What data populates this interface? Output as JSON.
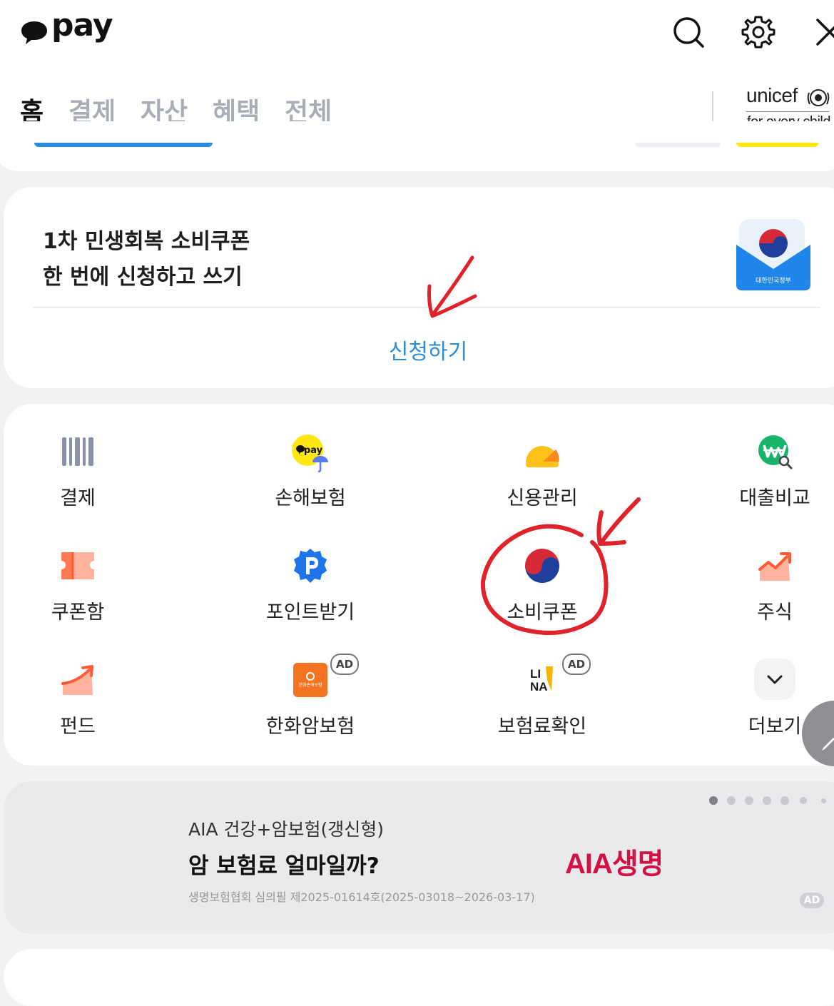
{
  "header": {
    "logo_text": "pay",
    "search_icon": "search-icon",
    "settings_icon": "gear-icon",
    "close_icon": "close-icon"
  },
  "tabs": [
    {
      "label": "홈",
      "active": true
    },
    {
      "label": "결제",
      "active": false
    },
    {
      "label": "자산",
      "active": false
    },
    {
      "label": "혜택",
      "active": false
    },
    {
      "label": "전체",
      "active": false
    }
  ],
  "partner": {
    "name": "unicef",
    "tagline": "for every child"
  },
  "banner": {
    "title_line1": "1차 민생회복 소비쿠폰",
    "title_line2": "한 번에 신청하고 쓰기",
    "envelope_label": "대한민국정부",
    "apply_label": "신청하기"
  },
  "shortcuts": [
    {
      "label": "결제",
      "icon": "barcode-icon",
      "ad": false
    },
    {
      "label": "손해보험",
      "icon": "kakaopay-insurance-icon",
      "ad": false,
      "icon_text": "pay"
    },
    {
      "label": "신용관리",
      "icon": "credit-gauge-icon",
      "ad": false
    },
    {
      "label": "대출비교",
      "icon": "won-search-icon",
      "ad": false
    },
    {
      "label": "쿠폰함",
      "icon": "coupon-icon",
      "ad": false
    },
    {
      "label": "포인트받기",
      "icon": "point-badge-icon",
      "ad": false
    },
    {
      "label": "소비쿠폰",
      "icon": "taegeuk-icon",
      "ad": false
    },
    {
      "label": "주식",
      "icon": "stock-chart-icon",
      "ad": false
    },
    {
      "label": "펀드",
      "icon": "fund-arrow-icon",
      "ad": false
    },
    {
      "label": "한화암보험",
      "icon": "hanwha-logo-icon",
      "ad": true,
      "ad_label": "AD",
      "icon_text": "한화손해보험"
    },
    {
      "label": "보험료확인",
      "icon": "lina-logo-icon",
      "ad": true,
      "ad_label": "AD",
      "icon_text_1": "LI",
      "icon_text_2": "NA"
    },
    {
      "label": "더보기",
      "icon": "chevron-down-icon",
      "ad": false
    }
  ],
  "ad_banner": {
    "subtitle": "AIA 건강+암보험(갱신형)",
    "title": "암 보험료 얼마일까?",
    "disclaimer": "생명보험협회 심의필 제2025-01614호(2025-03018~2026-03-17)",
    "brand": "AIA생명",
    "badge": "AD",
    "pages_total": 7,
    "page_active": 1
  },
  "colors": {
    "accent_blue": "#2b8bd6",
    "kakao_yellow": "#ffe812",
    "annotation_red": "#e0222b",
    "aia_red": "#d31145"
  },
  "annotations": [
    "red-arrow-to-apply",
    "red-circle-around-consumption-coupon"
  ]
}
